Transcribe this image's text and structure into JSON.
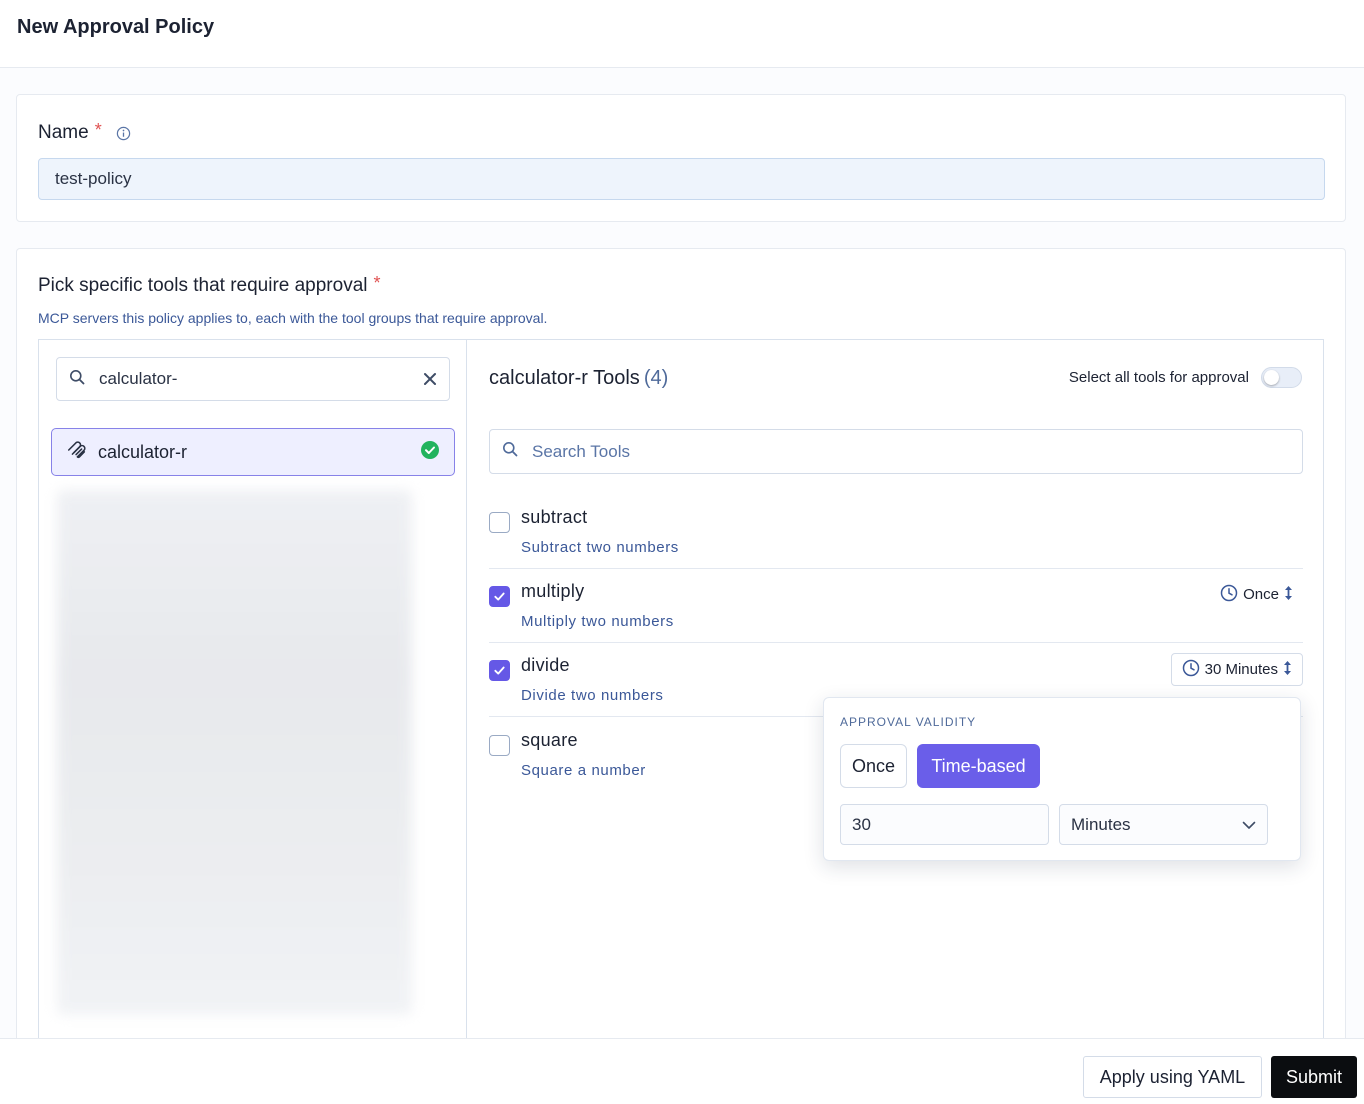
{
  "page": {
    "title": "New Approval Policy"
  },
  "name_section": {
    "label": "Name",
    "required_mark": "*",
    "value": "test-policy"
  },
  "tools_section": {
    "label": "Pick specific tools that require approval",
    "required_mark": "*",
    "subtitle": "MCP servers this policy applies to, each with the tool groups that require approval."
  },
  "server_search": {
    "value": "calculator-"
  },
  "servers": [
    {
      "name": "calculator-r",
      "selected": true,
      "status": "check-circle-icon"
    }
  ],
  "tools_panel": {
    "title": "calculator-r Tools",
    "count": "(4)",
    "select_all_label": "Select all tools for approval",
    "select_all_enabled": false,
    "search_placeholder": "Search Tools"
  },
  "tools": [
    {
      "name": "subtract",
      "description": "Subtract two numbers",
      "checked": false,
      "validity": ""
    },
    {
      "name": "multiply",
      "description": "Multiply two numbers",
      "checked": true,
      "validity": "Once"
    },
    {
      "name": "divide",
      "description": "Divide two numbers",
      "checked": true,
      "validity": "30 Minutes"
    },
    {
      "name": "square",
      "description": "Square a number",
      "checked": false,
      "validity": ""
    }
  ],
  "approval_validity": {
    "title": "APPROVAL VALIDITY",
    "options": [
      "Once",
      "Time-based"
    ],
    "selected": "Time-based",
    "amount": "30",
    "unit": "Minutes"
  },
  "footer": {
    "yaml_label": "Apply using YAML",
    "submit_label": "Submit"
  },
  "colors": {
    "accent": "#6a5ee9",
    "success": "#22b35e",
    "required": "#e05252"
  }
}
